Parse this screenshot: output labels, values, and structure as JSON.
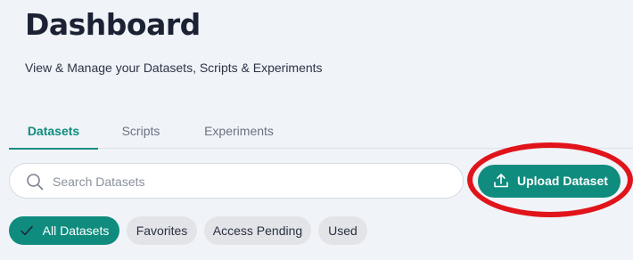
{
  "header": {
    "title": "Dashboard",
    "subtitle": "View & Manage your Datasets, Scripts & Experiments"
  },
  "tabs": [
    {
      "label": "Datasets",
      "active": true
    },
    {
      "label": "Scripts",
      "active": false
    },
    {
      "label": "Experiments",
      "active": false
    }
  ],
  "search": {
    "placeholder": "Search Datasets",
    "value": "",
    "icon": "search-icon"
  },
  "upload": {
    "label": "Upload Dataset",
    "icon": "upload-icon",
    "highlighted": true
  },
  "filters": [
    {
      "label": "All Datasets",
      "active": true,
      "icon": "check-icon"
    },
    {
      "label": "Favorites",
      "active": false
    },
    {
      "label": "Access Pending",
      "active": false
    },
    {
      "label": "Used",
      "active": false
    }
  ],
  "colors": {
    "accent": "#0f8c7e",
    "background": "#f0f3f8",
    "highlight_ring": "#e0141a",
    "chip_inactive": "#e2e4e8"
  }
}
